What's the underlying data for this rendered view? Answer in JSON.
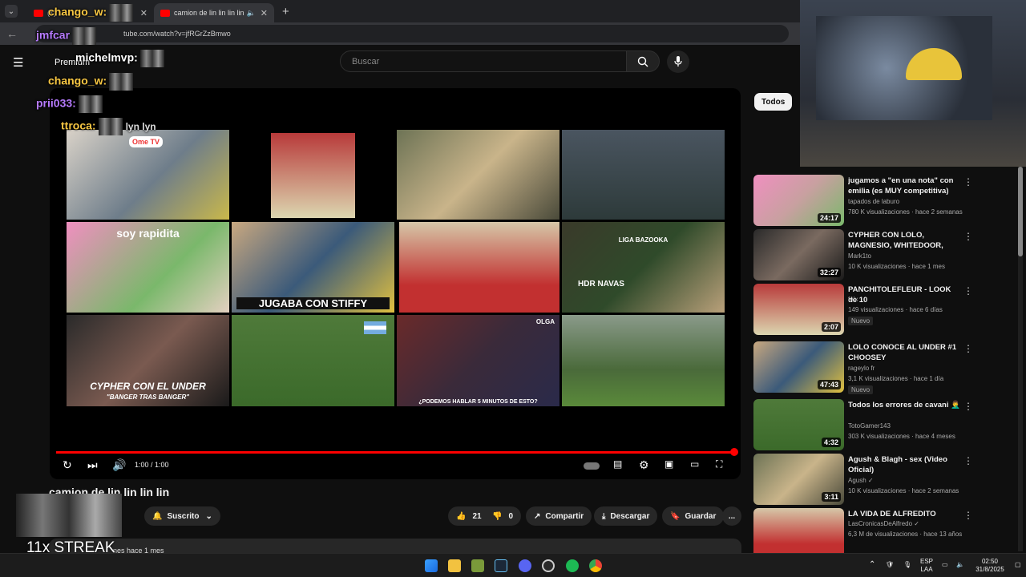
{
  "browser": {
    "tabs": [
      {
        "title": "(1) ...",
        "active": false
      },
      {
        "title": "camion de lin lin lin lin - YouTube",
        "active": true
      }
    ],
    "url": "tube.com/watch?v=jfRGrZzBmwo"
  },
  "masthead": {
    "logo_label": "Premium",
    "search_placeholder": "Buscar"
  },
  "player": {
    "time": "1:00 / 1:00",
    "progress_fraction": 1.0,
    "grid_captions": {
      "thumb5": "soy rapidita",
      "thumb6": "JUGABA CON STIFFY",
      "thumb8": "HDR NAVAS",
      "thumb8_top": "LIGA BAZOOKA",
      "thumb9": "CYPHER CON EL UNDER",
      "thumb9_sub": "\"BANGER TRAS BANGER\"",
      "thumb11": "¿PODEMOS HABLAR 5 MINUTOS DE ESTO?",
      "thumb11_brand": "OLGA",
      "thumb1_badge": "Ome TV"
    }
  },
  "video": {
    "title": "camion de lin lin lin lin",
    "subscribe_label": "Suscrito",
    "likes": "21",
    "dislikes": "0",
    "share_label": "Compartir",
    "download_label": "Descargar",
    "save_label": "Guardar",
    "more_label": "...",
    "desc_snippet": "nes hace 1 mes"
  },
  "sidebar": {
    "chip": "Todos",
    "recs": [
      {
        "title": "jugamos a \"en una nota\" con emilia (es MUY competitiva)",
        "channel": "tapados de laburo",
        "meta": "780 K visualizaciones · hace 2 semanas",
        "duration": "24:17",
        "badge": ""
      },
      {
        "title": "CYPHER CON LOLO, MAGNESIO, WHITEDOOR, JOVENALIEN Y ...",
        "channel": "Mark1to",
        "meta": "10 K visualizaciones · hace 1 mes",
        "duration": "32:27",
        "badge": ""
      },
      {
        "title": "PANCHITOLEFLEUR - LOOK de 10",
        "channel": "felx",
        "meta": "149 visualizaciones · hace 6 días",
        "duration": "2:07",
        "badge": "Nuevo"
      },
      {
        "title": "LOLO CONOCE AL UNDER #1 CHOOSEY",
        "channel": "rageylo fr",
        "meta": "3,1 K visualizaciones · hace 1 día",
        "duration": "47:43",
        "badge": "Nuevo"
      },
      {
        "title": "Todos los errores de cavani 🤦‍♂️",
        "channel": "TotoGamer143",
        "meta": "303 K visualizaciones · hace 4 meses",
        "duration": "4:32",
        "badge": ""
      },
      {
        "title": "Agush & Blagh - sex (Video Oficial)",
        "channel": "Agush ✓",
        "meta": "10 K visualizaciones · hace 2 semanas",
        "duration": "3:11",
        "badge": ""
      },
      {
        "title": "LA VIDA DE ALFREDITO",
        "channel": "LasCronicasDeAlfredo ✓",
        "meta": "6,3 M de visualizaciones · hace 13 años",
        "duration": "",
        "badge": ""
      }
    ]
  },
  "chat": [
    {
      "user": "chango_w:",
      "color": "#f5c542"
    },
    {
      "user": "jmfcar",
      "color": "#b77bff"
    },
    {
      "user": "michelmvp:",
      "color": "#ffffff"
    },
    {
      "user": "chango_w:",
      "color": "#f5c542"
    },
    {
      "user": "prii033:",
      "color": "#b77bff"
    },
    {
      "user": "ttroca:",
      "color": "#f5c542",
      "suffix": "lyn lyn"
    }
  ],
  "streak": "11x STREAK",
  "taskbar": {
    "lang_top": "ESP",
    "lang_bottom": "LAA",
    "time": "02:50",
    "date": "31/8/2025"
  },
  "colors": {
    "accent": "#ff0000",
    "bg": "#0f0f0f",
    "surface": "#272727"
  }
}
